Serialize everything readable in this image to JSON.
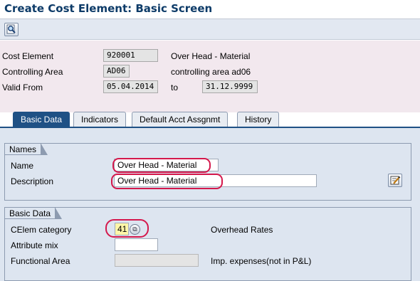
{
  "window": {
    "title": "Create Cost Element: Basic Screen"
  },
  "toolbar": {
    "display_icon": "magnifier-icon"
  },
  "header": {
    "cost_element_label": "Cost Element",
    "cost_element_value": "920001",
    "cost_element_desc": "Over Head - Material",
    "controlling_area_label": "Controlling Area",
    "controlling_area_value": "AD06",
    "controlling_area_desc": "controlling area ad06",
    "valid_from_label": "Valid From",
    "valid_from_value": "05.04.2014",
    "to_label": "to",
    "valid_to_value": "31.12.9999"
  },
  "tabs": [
    {
      "label": "Basic Data",
      "active": true
    },
    {
      "label": "Indicators",
      "active": false
    },
    {
      "label": "Default Acct Assgnmt",
      "active": false
    },
    {
      "label": "History",
      "active": false
    }
  ],
  "names_group": {
    "title": "Names",
    "name_label": "Name",
    "name_value": "Over Head - Material",
    "description_label": "Description",
    "description_value": "Over Head - Material",
    "edit_icon": "edit-text-icon"
  },
  "basic_data_group": {
    "title": "Basic Data",
    "celem_category_label": "CElem category",
    "celem_category_value": "41",
    "celem_category_desc": "Overhead Rates",
    "attribute_mix_label": "Attribute mix",
    "attribute_mix_value": "",
    "functional_area_label": "Functional Area",
    "functional_area_value": "",
    "functional_area_desc": "Imp. expenses(not in P&L)"
  },
  "colors": {
    "title": "#0d3b68",
    "active_tab": "#1f5185",
    "header_bg": "#f2e8ee",
    "content_bg": "#dde5f0",
    "highlight": "#d4184c",
    "category_field": "#fff6a8"
  }
}
